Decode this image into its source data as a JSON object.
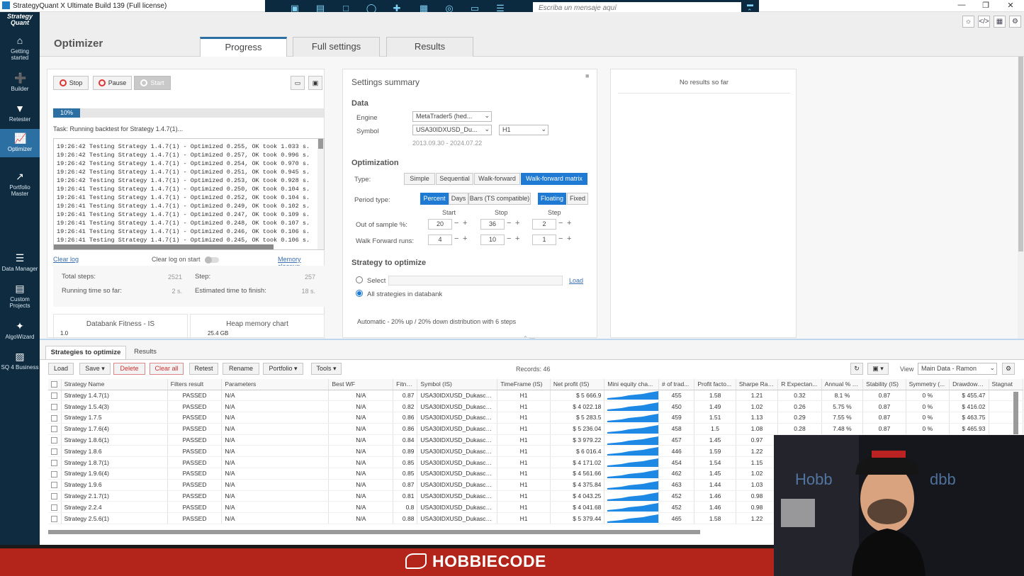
{
  "window": {
    "title": "StrategyQuant X Ultimate Build 139 (Full license)"
  },
  "remote_toolbar": {
    "message_placeholder": "Escriba un mensaje aquí"
  },
  "sidebar": {
    "logo_line1": "Strategy",
    "logo_line2": "Quant",
    "items": [
      {
        "line1": "Getting",
        "line2": "started"
      },
      {
        "line1": "Builder",
        "line2": ""
      },
      {
        "line1": "Retester",
        "line2": ""
      },
      {
        "line1": "Optimizer",
        "line2": ""
      },
      {
        "line1": "Portfolio",
        "line2": "Master"
      },
      {
        "line1": "Data Manager",
        "line2": ""
      },
      {
        "line1": "Custom",
        "line2": "Projects"
      },
      {
        "line1": "AlgoWizard",
        "line2": ""
      },
      {
        "line1": "SQ 4 Business",
        "line2": ""
      }
    ]
  },
  "header": {
    "page_title": "Optimizer",
    "tabs": [
      "Progress",
      "Full settings",
      "Results"
    ]
  },
  "progress": {
    "stop": "Stop",
    "pause": "Pause",
    "start": "Start",
    "percent_label": "10%",
    "percent": 10,
    "task": "Task: Running backtest for Strategy 1.4.7(1)...",
    "log": [
      "19:26:42 Testing Strategy 1.4.7(1) - Optimized 0.255, OK took 1.033 s.",
      "19:26:42 Testing Strategy 1.4.7(1) - Optimized 0.257, OK took 0.996 s.",
      "19:26:42 Testing Strategy 1.4.7(1) - Optimized 0.254, OK took 0.970 s.",
      "19:26:42 Testing Strategy 1.4.7(1) - Optimized 0.251, OK took 0.945 s.",
      "19:26:42 Testing Strategy 1.4.7(1) - Optimized 0.253, OK took 0.928 s.",
      "19:26:41 Testing Strategy 1.4.7(1) - Optimized 0.250, OK took 0.104 s.",
      "19:26:41 Testing Strategy 1.4.7(1) - Optimized 0.252, OK took 0.104 s.",
      "19:26:41 Testing Strategy 1.4.7(1) - Optimized 0.249, OK took 0.102 s.",
      "19:26:41 Testing Strategy 1.4.7(1) - Optimized 0.247, OK took 0.109 s.",
      "19:26:41 Testing Strategy 1.4.7(1) - Optimized 0.248, OK took 0.107 s.",
      "19:26:41 Testing Strategy 1.4.7(1) - Optimized 0.246, OK took 0.106 s.",
      "19:26:41 Testing Strategy 1.4.7(1) - Optimized 0.245, OK took 0.106 s."
    ],
    "clear_log": "Clear log",
    "clear_on_start": "Clear log on start",
    "memory_cleanup": "Memory cleanup",
    "total_steps_label": "Total steps:",
    "total_steps": "2521",
    "step_label": "Step:",
    "step": "257",
    "running_label": "Running time so far:",
    "running": "2 s.",
    "estimated_label": "Estimated time to finish:",
    "estimated": "18 s.",
    "fitness_title": "Databank Fitness - IS",
    "fitness_tick": "1.0",
    "heap_title": "Heap memory chart",
    "heap_value": "25.4 GB"
  },
  "settings": {
    "title": "Settings summary",
    "data_title": "Data",
    "engine_label": "Engine",
    "engine": "MetaTrader5 (hed...",
    "symbol_label": "Symbol",
    "symbol": "USA30IDXUSD_Du...",
    "timeframe": "H1",
    "range": "2013.09.30 - 2024.07.22",
    "opt_title": "Optimization",
    "type_label": "Type:",
    "types": [
      "Simple",
      "Sequential",
      "Walk-forward",
      "Walk-forward matrix"
    ],
    "type_selected": "Walk-forward matrix",
    "period_label": "Period type:",
    "periods": [
      "Percent",
      "Days",
      "Bars (TS compatible)"
    ],
    "period_selected": "Percent",
    "modes": [
      "Floating",
      "Fixed"
    ],
    "mode_selected": "Floating",
    "col_start": "Start",
    "col_stop": "Stop",
    "col_step": "Step",
    "oos_label": "Out of sample %:",
    "oos": [
      "20",
      "36",
      "2"
    ],
    "wf_label": "Walk Forward runs:",
    "wf": [
      "4",
      "10",
      "1"
    ],
    "strat_title": "Strategy to optimize",
    "select_label": "Select",
    "load": "Load",
    "all_label": "All strategies in databank",
    "summary": "Automatic - 20% up / 20% down distribution with 6 steps"
  },
  "results_panel": {
    "empty": "No results so far"
  },
  "bottom": {
    "tabs": [
      "Strategies to optimize",
      "Results"
    ],
    "buttons": {
      "load": "Load",
      "save": "Save",
      "delete": "Delete",
      "clear_all": "Clear all",
      "retest": "Retest",
      "rename": "Rename",
      "portfolio": "Portfolio",
      "tools": "Tools"
    },
    "records": "Records: 46",
    "view_label": "View",
    "view": "Main Data - Ramon",
    "columns": [
      "Strategy Name",
      "Filters result",
      "Parameters",
      "Best WF",
      "Fitne...",
      "Symbol (IS)",
      "TimeFrame (IS)",
      "Net profit (IS)",
      "Mini equity cha...",
      "# of trad...",
      "Profit facto...",
      "Sharpe Rati...",
      "R Expectan...",
      "Annual % R...",
      "Stability (IS)",
      "Symmetry (...",
      "Drawdown ...",
      "Stagnat"
    ],
    "rows": [
      [
        "Strategy 1.4.7(1)",
        "PASSED",
        "N/A",
        "N/A",
        "0.87",
        "USA30IDXUSD_Dukascop...",
        "H1",
        "$ 5 666.9",
        "455",
        "1.58",
        "1.21",
        "0.32",
        "8.1 %",
        "0.87",
        "0 %",
        "$ 455.47"
      ],
      [
        "Strategy 1.5.4(3)",
        "PASSED",
        "N/A",
        "N/A",
        "0.82",
        "USA30IDXUSD_Dukascop...",
        "H1",
        "$ 4 022.18",
        "450",
        "1.49",
        "1.02",
        "0.26",
        "5.75 %",
        "0.87",
        "0 %",
        "$ 416.02"
      ],
      [
        "Strategy 1.7.5",
        "PASSED",
        "N/A",
        "N/A",
        "0.86",
        "USA30IDXUSD_Dukascop...",
        "H1",
        "$ 5 283.5",
        "459",
        "1.51",
        "1.13",
        "0.29",
        "7.55 %",
        "0.87",
        "0 %",
        "$ 463.75"
      ],
      [
        "Strategy 1.7.6(4)",
        "PASSED",
        "N/A",
        "N/A",
        "0.86",
        "USA30IDXUSD_Dukascop...",
        "H1",
        "$ 5 236.04",
        "458",
        "1.5",
        "1.08",
        "0.28",
        "7.48 %",
        "0.87",
        "0 %",
        "$ 465.93"
      ],
      [
        "Strategy 1.8.6(1)",
        "PASSED",
        "N/A",
        "N/A",
        "0.84",
        "USA30IDXUSD_Dukascop...",
        "H1",
        "$ 3 979.22",
        "457",
        "1.45",
        "0.97",
        "",
        "",
        "",
        "",
        ""
      ],
      [
        "Strategy 1.8.6",
        "PASSED",
        "N/A",
        "N/A",
        "0.89",
        "USA30IDXUSD_Dukascop...",
        "H1",
        "$ 6 016.4",
        "446",
        "1.59",
        "1.22",
        "",
        "",
        "",
        "",
        ""
      ],
      [
        "Strategy 1.8.7(1)",
        "PASSED",
        "N/A",
        "N/A",
        "0.85",
        "USA30IDXUSD_Dukascop...",
        "H1",
        "$ 4 171.02",
        "454",
        "1.54",
        "1.15",
        "",
        "",
        "",
        "",
        ""
      ],
      [
        "Strategy 1.9.6(4)",
        "PASSED",
        "N/A",
        "N/A",
        "0.85",
        "USA30IDXUSD_Dukascop...",
        "H1",
        "$ 4 561.66",
        "462",
        "1.45",
        "1.02",
        "",
        "",
        "",
        "",
        ""
      ],
      [
        "Strategy 1.9.6",
        "PASSED",
        "N/A",
        "N/A",
        "0.87",
        "USA30IDXUSD_Dukascop...",
        "H1",
        "$ 4 375.84",
        "463",
        "1.44",
        "1.03",
        "",
        "",
        "",
        "",
        ""
      ],
      [
        "Strategy 2.1.7(1)",
        "PASSED",
        "N/A",
        "N/A",
        "0.81",
        "USA30IDXUSD_Dukascop...",
        "H1",
        "$ 4 043.25",
        "452",
        "1.46",
        "0.98",
        "",
        "",
        "",
        "",
        ""
      ],
      [
        "Strategy 2.2.4",
        "PASSED",
        "N/A",
        "N/A",
        "0.8",
        "USA30IDXUSD_Dukascop...",
        "H1",
        "$ 4 041.68",
        "452",
        "1.46",
        "0.98",
        "",
        "",
        "",
        "",
        ""
      ],
      [
        "Strategy 2.5.6(1)",
        "PASSED",
        "N/A",
        "N/A",
        "0.88",
        "USA30IDXUSD_Dukascop...",
        "H1",
        "$ 5 379.44",
        "465",
        "1.58",
        "1.22",
        "",
        "",
        "",
        "",
        ""
      ]
    ]
  },
  "overlay": {
    "brand": "HOBBIECODE"
  },
  "colors": {
    "sidebar": "#0e2b40",
    "accent": "#1e7ad2",
    "passed": "#25a34b",
    "profit": "#c0392b",
    "banner": "#b3251b"
  }
}
